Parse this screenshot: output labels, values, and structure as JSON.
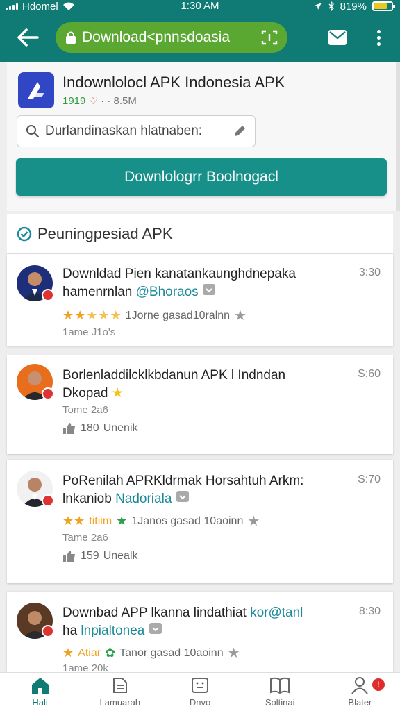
{
  "status_bar": {
    "carrier": "Hdomel",
    "time": "1:30 AM",
    "battery_text": "819%"
  },
  "app_bar": {
    "url": "Download<pnnsdoasia"
  },
  "app": {
    "title": "Indownlolocl APK Indonesia APK",
    "rating": "1919",
    "meta": "· · 8.5M",
    "icon_color": "#3046c4"
  },
  "search": {
    "placeholder": "Durlandinaskan hlatnaben:"
  },
  "download_button": {
    "label": "Downlologrr Boolnogacl"
  },
  "section": {
    "title": "Peuningpesiad APK"
  },
  "posts": [
    {
      "text": "Downldad Pien kanatankaunghdnepaka",
      "text2_plain": "hamenrnlan ",
      "text2_hl": "@Bhoraos",
      "time": "3:30",
      "rating_label": "1Jorne gasad10ralnn",
      "sub": "1ame J1o's"
    },
    {
      "text": "Borlenladdilcklkbdanun APK l Indndan",
      "text2_plain": "Dkopad",
      "time": "S:60",
      "sub": "Tome 2a6",
      "likes": "180",
      "likes_label": "Unenik"
    },
    {
      "text": "PoRenilah APRKldrmak Horsahtuh Arkm:",
      "text2_plain": "lnkaniob ",
      "text2_hl": "Nadoriala",
      "time": "S:70",
      "rating_label": "1Janos gasad 10aoinn",
      "rating_word": "titiim",
      "sub": "Tame 2a6",
      "likes": "159",
      "likes_label": "Unealk"
    },
    {
      "text_plain": "Downbad APP lkanna lindathiat ",
      "text_hl": "kor@tanl",
      "text2_plain": "ha ",
      "text2_hl": "lnpialtonea",
      "time": "8:30",
      "rating_word": "Atiar",
      "rating_label": "Tanor gasad 10aoinn",
      "sub": "1ame 20k"
    }
  ],
  "bottom_nav": [
    {
      "label": "Hali",
      "active": true
    },
    {
      "label": "Lamuarah"
    },
    {
      "label": "Dnvo"
    },
    {
      "label": "Soltinai"
    },
    {
      "label": "Blater",
      "badge": "!"
    }
  ],
  "colors": {
    "primary": "#0f7b74",
    "url_pill": "#5aa832",
    "download": "#17908a",
    "star": "#f0a21e",
    "highlight": "#1b8a99"
  }
}
